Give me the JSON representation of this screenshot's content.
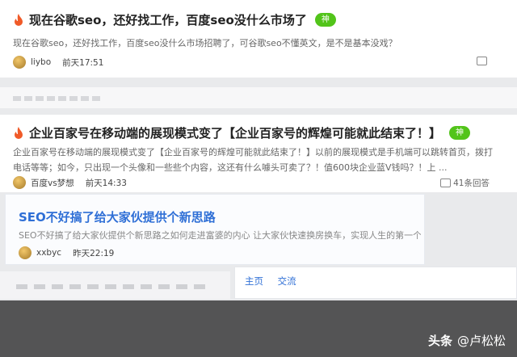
{
  "posts": [
    {
      "title": "现在谷歌seo，还好找工作，百度seo没什么市场了",
      "badge": "神",
      "description": "现在谷歌seo，还好找工作，百度seo没什么市场招聘了，可谷歌seo不懂英文，是不是基本没戏？",
      "author": "liybo",
      "time": "前天17:51",
      "comments": ""
    },
    {
      "title": "企业百家号在移动端的展现模式变了【企业百家号的辉煌可能就此结束了！】",
      "badge": "神",
      "description": "企业百家号在移动端的展现模式变了【企业百家号的辉煌可能就此结束了！】以前的展现模式是手机端可以跳转首页，拨打电话等等；如今，只出现一个头像和一些些个内容，这还有什么噱头可卖了？！值600块企业蓝V钱吗？！上 ...",
      "author": "百度vs梦想",
      "time": "前天14:33",
      "comments": "41条回答"
    },
    {
      "title": "SEO不好搞了给大家伙提供个新思路",
      "description": "SEO不好搞了给大家伙提供个新思路之如何走进富婆的内心 让大家伙快速换房换车，实现人生的第一个小目",
      "author": "xxbyc",
      "time": "昨天22:19"
    }
  ],
  "breadcrumb": [
    "主页",
    "交流"
  ],
  "watermark": {
    "brand": "头条",
    "handle": "@卢松松"
  },
  "colors": {
    "badge": "#52c41a",
    "link": "#2f6fd6",
    "fire": "#f05a28",
    "footer": "#545455"
  }
}
